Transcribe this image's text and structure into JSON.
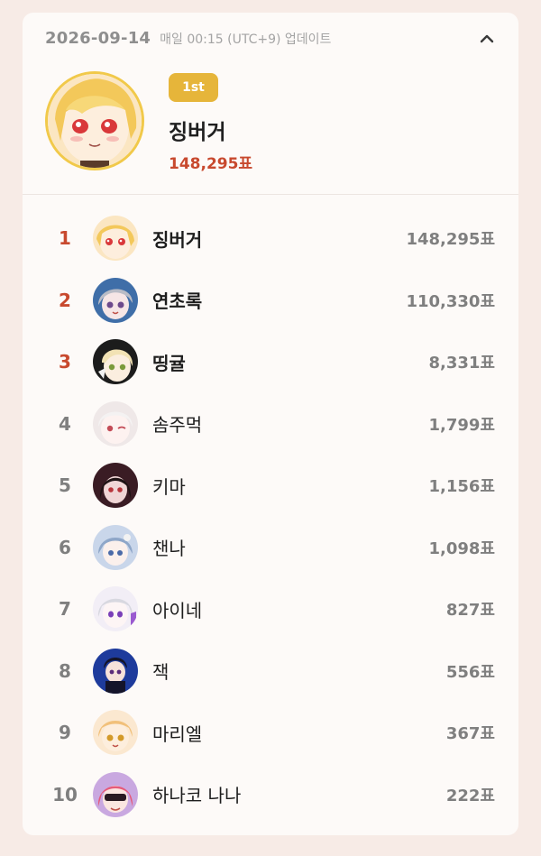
{
  "header": {
    "date": "2026-09-14",
    "update_note": "매일 00:15 (UTC+9) 업데이트",
    "collapse_icon": "chevron-up-icon"
  },
  "top": {
    "badge": "1st",
    "name": "징버거",
    "votes": "148,295표"
  },
  "rankings": [
    {
      "rank": "1",
      "name": "징버거",
      "votes": "148,295표"
    },
    {
      "rank": "2",
      "name": "연초록",
      "votes": "110,330표"
    },
    {
      "rank": "3",
      "name": "띵귤",
      "votes": "8,331표"
    },
    {
      "rank": "4",
      "name": "솜주먹",
      "votes": "1,799표"
    },
    {
      "rank": "5",
      "name": "키마",
      "votes": "1,156표"
    },
    {
      "rank": "6",
      "name": "챈나",
      "votes": "1,098표"
    },
    {
      "rank": "7",
      "name": "아이네",
      "votes": "827표"
    },
    {
      "rank": "8",
      "name": "잭",
      "votes": "556표"
    },
    {
      "rank": "9",
      "name": "마리엘",
      "votes": "367표"
    },
    {
      "rank": "10",
      "name": "하나코 나나",
      "votes": "222표"
    }
  ],
  "colors": {
    "background": "#f7ebe6",
    "card": "#fdfaf8",
    "badge": "#e6b53a",
    "accent_red": "#c8492e",
    "muted": "#7f7f7f"
  }
}
